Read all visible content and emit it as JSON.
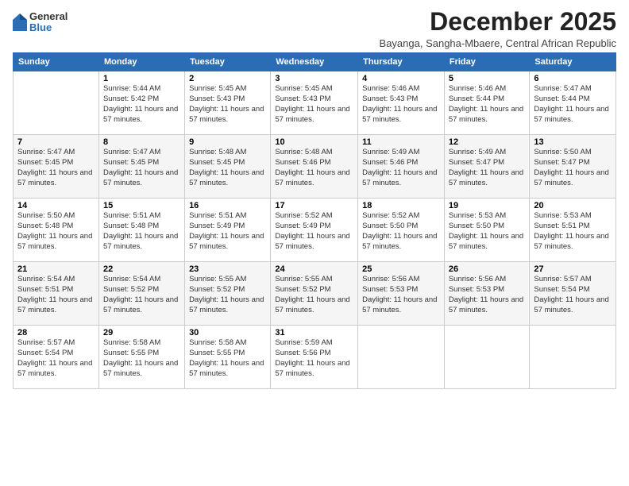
{
  "logo": {
    "general": "General",
    "blue": "Blue"
  },
  "header": {
    "title": "December 2025",
    "subtitle": "Bayanga, Sangha-Mbaere, Central African Republic"
  },
  "days_of_week": [
    "Sunday",
    "Monday",
    "Tuesday",
    "Wednesday",
    "Thursday",
    "Friday",
    "Saturday"
  ],
  "weeks": [
    [
      {
        "day": "",
        "sunrise": "",
        "sunset": "",
        "daylight": ""
      },
      {
        "day": "1",
        "sunrise": "Sunrise: 5:44 AM",
        "sunset": "Sunset: 5:42 PM",
        "daylight": "Daylight: 11 hours and 57 minutes."
      },
      {
        "day": "2",
        "sunrise": "Sunrise: 5:45 AM",
        "sunset": "Sunset: 5:43 PM",
        "daylight": "Daylight: 11 hours and 57 minutes."
      },
      {
        "day": "3",
        "sunrise": "Sunrise: 5:45 AM",
        "sunset": "Sunset: 5:43 PM",
        "daylight": "Daylight: 11 hours and 57 minutes."
      },
      {
        "day": "4",
        "sunrise": "Sunrise: 5:46 AM",
        "sunset": "Sunset: 5:43 PM",
        "daylight": "Daylight: 11 hours and 57 minutes."
      },
      {
        "day": "5",
        "sunrise": "Sunrise: 5:46 AM",
        "sunset": "Sunset: 5:44 PM",
        "daylight": "Daylight: 11 hours and 57 minutes."
      },
      {
        "day": "6",
        "sunrise": "Sunrise: 5:47 AM",
        "sunset": "Sunset: 5:44 PM",
        "daylight": "Daylight: 11 hours and 57 minutes."
      }
    ],
    [
      {
        "day": "7",
        "sunrise": "Sunrise: 5:47 AM",
        "sunset": "Sunset: 5:45 PM",
        "daylight": "Daylight: 11 hours and 57 minutes."
      },
      {
        "day": "8",
        "sunrise": "Sunrise: 5:47 AM",
        "sunset": "Sunset: 5:45 PM",
        "daylight": "Daylight: 11 hours and 57 minutes."
      },
      {
        "day": "9",
        "sunrise": "Sunrise: 5:48 AM",
        "sunset": "Sunset: 5:45 PM",
        "daylight": "Daylight: 11 hours and 57 minutes."
      },
      {
        "day": "10",
        "sunrise": "Sunrise: 5:48 AM",
        "sunset": "Sunset: 5:46 PM",
        "daylight": "Daylight: 11 hours and 57 minutes."
      },
      {
        "day": "11",
        "sunrise": "Sunrise: 5:49 AM",
        "sunset": "Sunset: 5:46 PM",
        "daylight": "Daylight: 11 hours and 57 minutes."
      },
      {
        "day": "12",
        "sunrise": "Sunrise: 5:49 AM",
        "sunset": "Sunset: 5:47 PM",
        "daylight": "Daylight: 11 hours and 57 minutes."
      },
      {
        "day": "13",
        "sunrise": "Sunrise: 5:50 AM",
        "sunset": "Sunset: 5:47 PM",
        "daylight": "Daylight: 11 hours and 57 minutes."
      }
    ],
    [
      {
        "day": "14",
        "sunrise": "Sunrise: 5:50 AM",
        "sunset": "Sunset: 5:48 PM",
        "daylight": "Daylight: 11 hours and 57 minutes."
      },
      {
        "day": "15",
        "sunrise": "Sunrise: 5:51 AM",
        "sunset": "Sunset: 5:48 PM",
        "daylight": "Daylight: 11 hours and 57 minutes."
      },
      {
        "day": "16",
        "sunrise": "Sunrise: 5:51 AM",
        "sunset": "Sunset: 5:49 PM",
        "daylight": "Daylight: 11 hours and 57 minutes."
      },
      {
        "day": "17",
        "sunrise": "Sunrise: 5:52 AM",
        "sunset": "Sunset: 5:49 PM",
        "daylight": "Daylight: 11 hours and 57 minutes."
      },
      {
        "day": "18",
        "sunrise": "Sunrise: 5:52 AM",
        "sunset": "Sunset: 5:50 PM",
        "daylight": "Daylight: 11 hours and 57 minutes."
      },
      {
        "day": "19",
        "sunrise": "Sunrise: 5:53 AM",
        "sunset": "Sunset: 5:50 PM",
        "daylight": "Daylight: 11 hours and 57 minutes."
      },
      {
        "day": "20",
        "sunrise": "Sunrise: 5:53 AM",
        "sunset": "Sunset: 5:51 PM",
        "daylight": "Daylight: 11 hours and 57 minutes."
      }
    ],
    [
      {
        "day": "21",
        "sunrise": "Sunrise: 5:54 AM",
        "sunset": "Sunset: 5:51 PM",
        "daylight": "Daylight: 11 hours and 57 minutes."
      },
      {
        "day": "22",
        "sunrise": "Sunrise: 5:54 AM",
        "sunset": "Sunset: 5:52 PM",
        "daylight": "Daylight: 11 hours and 57 minutes."
      },
      {
        "day": "23",
        "sunrise": "Sunrise: 5:55 AM",
        "sunset": "Sunset: 5:52 PM",
        "daylight": "Daylight: 11 hours and 57 minutes."
      },
      {
        "day": "24",
        "sunrise": "Sunrise: 5:55 AM",
        "sunset": "Sunset: 5:52 PM",
        "daylight": "Daylight: 11 hours and 57 minutes."
      },
      {
        "day": "25",
        "sunrise": "Sunrise: 5:56 AM",
        "sunset": "Sunset: 5:53 PM",
        "daylight": "Daylight: 11 hours and 57 minutes."
      },
      {
        "day": "26",
        "sunrise": "Sunrise: 5:56 AM",
        "sunset": "Sunset: 5:53 PM",
        "daylight": "Daylight: 11 hours and 57 minutes."
      },
      {
        "day": "27",
        "sunrise": "Sunrise: 5:57 AM",
        "sunset": "Sunset: 5:54 PM",
        "daylight": "Daylight: 11 hours and 57 minutes."
      }
    ],
    [
      {
        "day": "28",
        "sunrise": "Sunrise: 5:57 AM",
        "sunset": "Sunset: 5:54 PM",
        "daylight": "Daylight: 11 hours and 57 minutes."
      },
      {
        "day": "29",
        "sunrise": "Sunrise: 5:58 AM",
        "sunset": "Sunset: 5:55 PM",
        "daylight": "Daylight: 11 hours and 57 minutes."
      },
      {
        "day": "30",
        "sunrise": "Sunrise: 5:58 AM",
        "sunset": "Sunset: 5:55 PM",
        "daylight": "Daylight: 11 hours and 57 minutes."
      },
      {
        "day": "31",
        "sunrise": "Sunrise: 5:59 AM",
        "sunset": "Sunset: 5:56 PM",
        "daylight": "Daylight: 11 hours and 57 minutes."
      },
      {
        "day": "",
        "sunrise": "",
        "sunset": "",
        "daylight": ""
      },
      {
        "day": "",
        "sunrise": "",
        "sunset": "",
        "daylight": ""
      },
      {
        "day": "",
        "sunrise": "",
        "sunset": "",
        "daylight": ""
      }
    ]
  ]
}
